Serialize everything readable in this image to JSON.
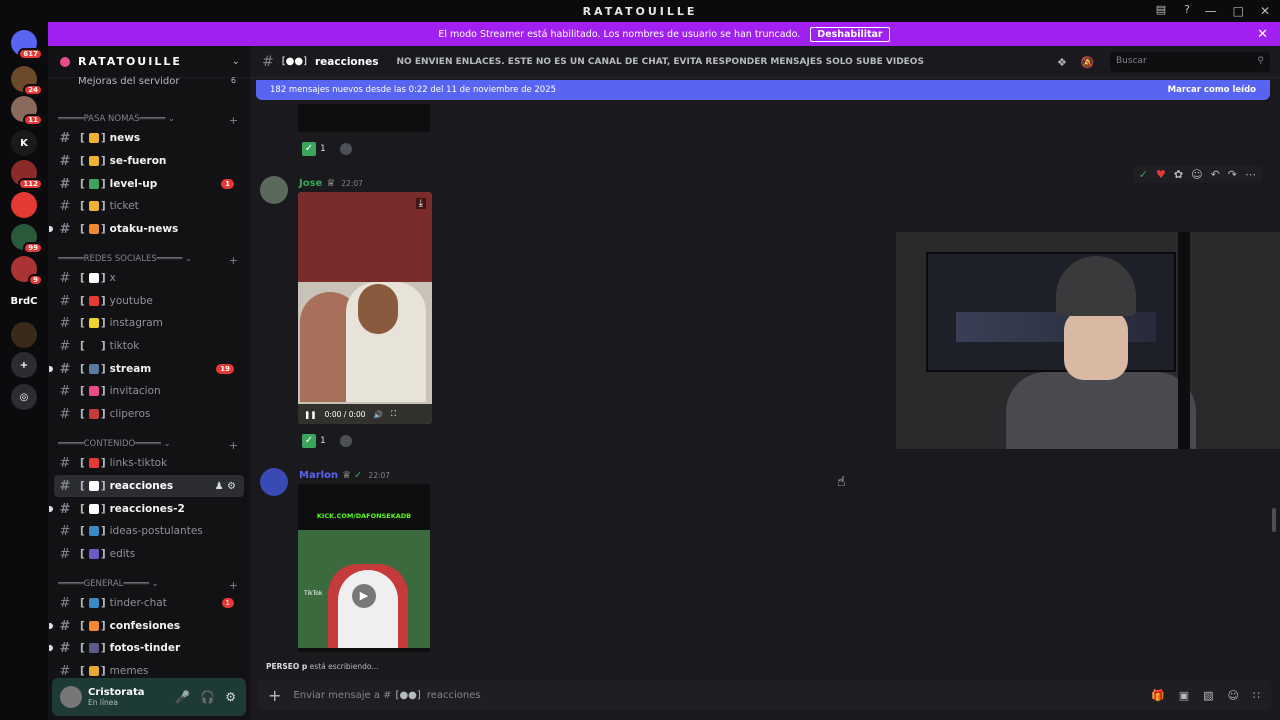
{
  "window": {
    "title": "RATATOUILLE"
  },
  "servers": [
    {
      "label": "",
      "badge": "617",
      "color": "#5865f2"
    },
    {
      "label": "",
      "badge": "24",
      "color": "#6b4a2a"
    },
    {
      "label": "",
      "badge": "11",
      "color": "#8a6a5a"
    },
    {
      "label": "K",
      "badge": "",
      "color": "#1a1a1a"
    },
    {
      "label": "",
      "badge": "112",
      "color": "#8a2a2a"
    },
    {
      "label": "",
      "badge": "",
      "color": "#e53935"
    },
    {
      "label": "",
      "badge": "99",
      "color": "#2a5a3a"
    },
    {
      "label": "",
      "badge": "9",
      "color": "#aa3333"
    },
    {
      "label": "BrdC",
      "badge": "",
      "color": "#0b0b0d"
    },
    {
      "label": "",
      "badge": "",
      "color": "#3a2a1a"
    },
    {
      "label": "+",
      "badge": "",
      "color": "#2b2d31"
    },
    {
      "label": "◎",
      "badge": "",
      "color": "#2b2d31"
    }
  ],
  "streamer": {
    "text": "El modo Streamer está habilitado. Los nombres de usuario se han truncado.",
    "button": "Deshabilitar"
  },
  "guild": {
    "name": "RATATOUILLE",
    "boost": "Mejoras del servidor",
    "boost_count": "6"
  },
  "categories": {
    "pasa": "═════PASA NOMAS═════ ⌄",
    "redes": "═════REDES SOCIALES═════ ⌄",
    "contenido": "═════CONTENIDO═════ ⌄",
    "general": "═════GENERAL═════ ⌄"
  },
  "channels": [
    {
      "name": "news",
      "bold": true,
      "color": "#f0b232",
      "count": "",
      "dot": false
    },
    {
      "name": "se-fueron",
      "bold": true,
      "color": "#f0b232",
      "count": "",
      "dot": false
    },
    {
      "name": "level-up",
      "bold": true,
      "color": "#3ba55c",
      "count": "1",
      "dot": false
    },
    {
      "name": "ticket",
      "bold": false,
      "color": "#f0b232",
      "count": "",
      "dot": false
    },
    {
      "name": "otaku-news",
      "bold": true,
      "color": "#f08a32",
      "count": "",
      "dot": true
    },
    {
      "name": "x",
      "bold": false,
      "color": "#ffffff",
      "count": "",
      "dot": false
    },
    {
      "name": "youtube",
      "bold": false,
      "color": "#e53935",
      "count": "",
      "dot": false
    },
    {
      "name": "instagram",
      "bold": false,
      "color": "#f0d232",
      "count": "",
      "dot": false
    },
    {
      "name": "tiktok",
      "bold": false,
      "color": "#111111",
      "count": "",
      "dot": false
    },
    {
      "name": "stream",
      "bold": true,
      "color": "#5a7aa0",
      "count": "19",
      "dot": true
    },
    {
      "name": "invitacion",
      "bold": false,
      "color": "#e84a8a",
      "count": "",
      "dot": false
    },
    {
      "name": "cliperos",
      "bold": false,
      "color": "#c53a3a",
      "count": "",
      "dot": false
    },
    {
      "name": "links-tiktok",
      "bold": false,
      "color": "#e53935",
      "count": "",
      "dot": false
    },
    {
      "name": "reacciones",
      "bold": true,
      "color": "#ffffff",
      "count": "",
      "dot": false
    },
    {
      "name": "reacciones-2",
      "bold": true,
      "color": "#ffffff",
      "count": "",
      "dot": true
    },
    {
      "name": "ideas-postulantes",
      "bold": false,
      "color": "#3a8ac5",
      "count": "",
      "dot": false
    },
    {
      "name": "edits",
      "bold": false,
      "color": "#6a5ac5",
      "count": "",
      "dot": false
    },
    {
      "name": "tinder-chat",
      "bold": false,
      "color": "#3a8ac5",
      "count": "1",
      "dot": false
    },
    {
      "name": "confesiones",
      "bold": true,
      "color": "#f08a32",
      "count": "",
      "dot": true
    },
    {
      "name": "fotos-tinder",
      "bold": true,
      "color": "#5a5a8a",
      "count": "",
      "dot": true
    },
    {
      "name": "memes",
      "bold": false,
      "color": "#e5a835",
      "count": "",
      "dot": false
    }
  ],
  "user": {
    "name": "Cristorata",
    "status": "En línea"
  },
  "header": {
    "channel": "reacciones",
    "topic": "NO ENVIEN ENLACES. ESTE NO ES UN CANAL DE CHAT, EVITA RESPONDER MENSAJES SOLO SUBE VIDEOS",
    "search_placeholder": "Buscar"
  },
  "newbar": {
    "text": "182 mensajes nuevos desde las 0:22 del 11 de noviembre de 2025",
    "mark": "Marcar como leído"
  },
  "reactions": [
    {
      "count": "1"
    },
    {
      "count": "1"
    }
  ],
  "messages": [
    {
      "author": "Jose",
      "time": "22:07",
      "color": "#3ba55c",
      "video_time": "0:00 / 0:00"
    },
    {
      "author": "Marlon",
      "time": "22:07",
      "color": "#5865f2",
      "embed_text": "KICK.COM/DAFONSEKADB",
      "brand": "TikTok"
    }
  ],
  "typing": {
    "user": "PERSEO p",
    "text": "está escribiendo..."
  },
  "composer": {
    "placeholder": "Enviar mensaje a #",
    "channel": "reacciones"
  }
}
